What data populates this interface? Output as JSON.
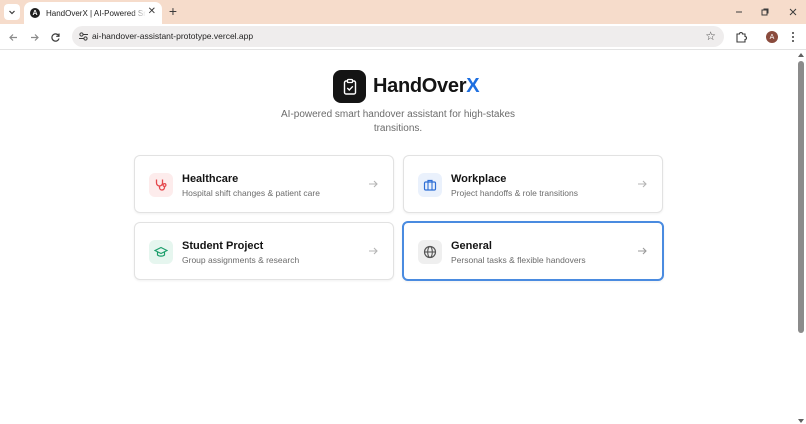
{
  "browser": {
    "tab_title": "HandOverX | AI-Powered Smart",
    "tab_favicon_letter": "A",
    "url": "ai-handover-assistant-prototype.vercel.app",
    "profile_initial": "A",
    "icons": {
      "tab_menu": "chevron-down-icon",
      "tab_close": "close-icon",
      "new_tab": "plus-icon",
      "minimize": "minimize-icon",
      "restore": "restore-icon",
      "close_window": "close-icon",
      "back": "arrow-left-icon",
      "forward": "arrow-right-icon",
      "reload": "reload-icon",
      "site_info": "tune-icon",
      "bookmark": "star-icon",
      "extensions": "puzzle-icon",
      "menu": "kebab-icon"
    }
  },
  "hero": {
    "brand_main": "HandOver",
    "brand_accent": "X",
    "logo_icon": "clipboard-check-icon",
    "tagline": "AI-powered smart handover assistant for high-stakes transitions."
  },
  "categories": [
    {
      "title": "Healthcare",
      "subtitle": "Hospital shift changes & patient care",
      "icon": "stethoscope-icon",
      "accent": "#e5484d",
      "selected": false
    },
    {
      "title": "Workplace",
      "subtitle": "Project handoffs & role transitions",
      "icon": "briefcase-icon",
      "accent": "#2f6fd6",
      "selected": false
    },
    {
      "title": "Student Project",
      "subtitle": "Group assignments & research",
      "icon": "graduation-cap-icon",
      "accent": "#1a9d6a",
      "selected": false
    },
    {
      "title": "General",
      "subtitle": "Personal tasks & flexible handovers",
      "icon": "globe-icon",
      "accent": "#555555",
      "selected": true
    }
  ],
  "colors": {
    "tabstrip": "#f6dccb",
    "brand_accent": "#1e6fe0",
    "selected_border": "#4a8be0"
  }
}
